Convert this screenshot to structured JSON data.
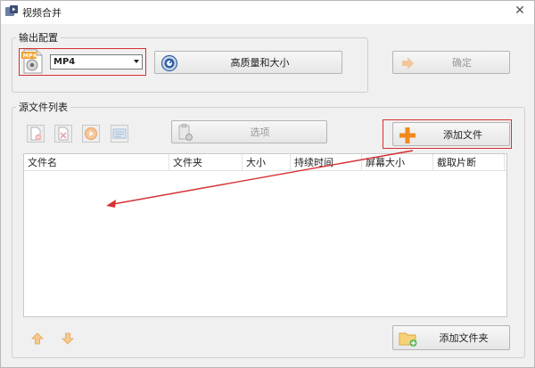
{
  "window": {
    "title": "视频合并",
    "close_glyph": "✕"
  },
  "output_config": {
    "legend": "输出配置",
    "format_icon": "mp4-file-icon",
    "format_badge": "MP4",
    "format_value": "MP4",
    "quality_button": "高质量和大小",
    "ok_button": "确定"
  },
  "source_list": {
    "legend": "源文件列表",
    "toolbar_icons": [
      "remove-file-icon",
      "clear-list-icon",
      "play-icon",
      "info-icon"
    ],
    "options_button": "选项",
    "add_file_button": "添加文件",
    "columns": [
      "文件名",
      "文件夹",
      "大小",
      "持续时间",
      "屏幕大小",
      "截取片断"
    ],
    "rows": [],
    "add_folder_button": "添加文件夹"
  },
  "colors": {
    "annotation_red": "#d63031",
    "plus_orange": "#f08a1c"
  }
}
